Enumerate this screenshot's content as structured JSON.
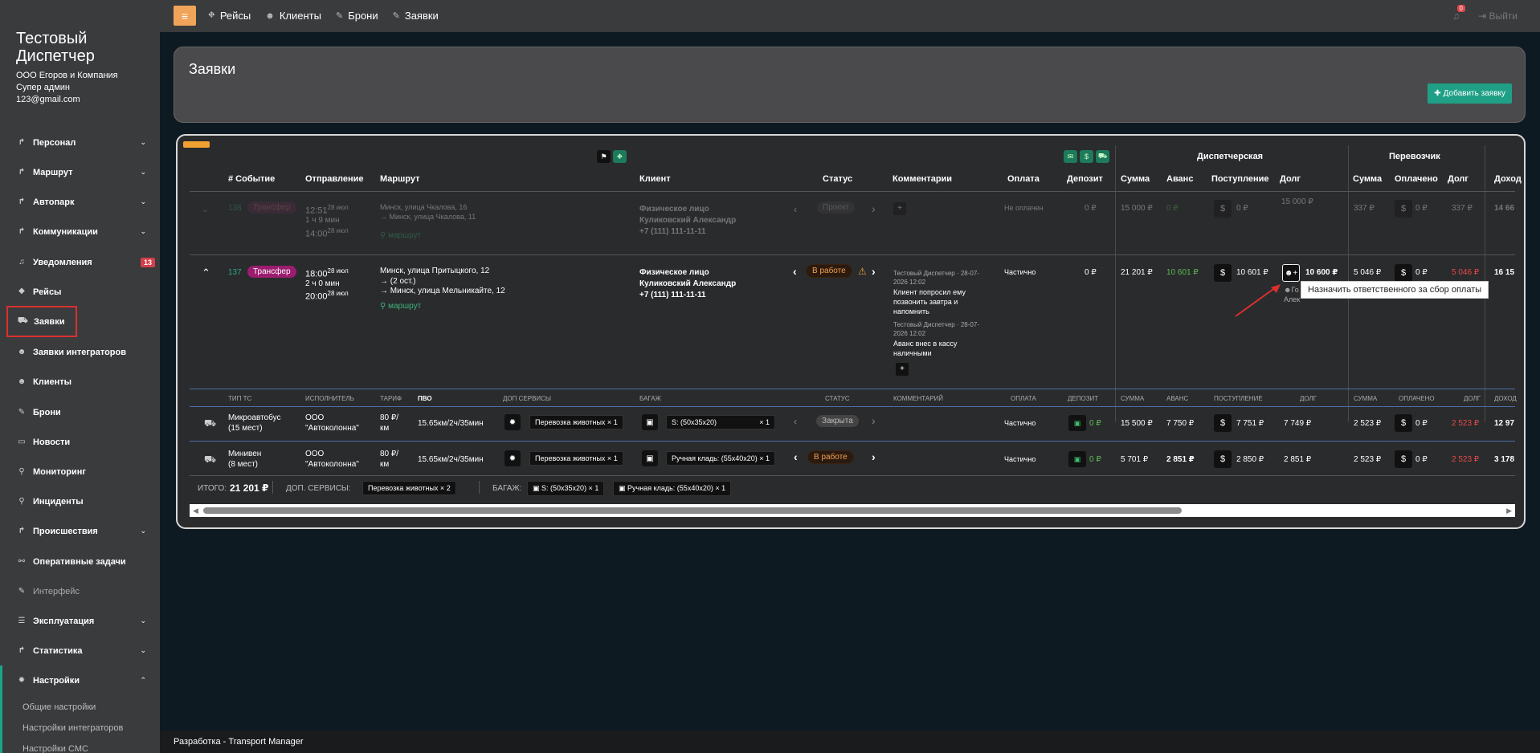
{
  "brand": {
    "title_line1": "Тестовый",
    "title_line2": "Диспетчер",
    "company": "ООО Егоров и Компания",
    "role": "Супер админ",
    "email": "123@gmail.com"
  },
  "sidebar": {
    "items": [
      {
        "label": "Персонал",
        "icon": "route-icon"
      },
      {
        "label": "Маршрут",
        "icon": "route-icon"
      },
      {
        "label": "Автопарк",
        "icon": "route-icon"
      },
      {
        "label": "Коммуникации",
        "icon": "route-icon"
      },
      {
        "label": "Уведомления",
        "icon": "bell-icon",
        "badge": "13"
      },
      {
        "label": "Рейсы",
        "icon": "road-icon"
      },
      {
        "label": "Заявки",
        "icon": "car-icon"
      },
      {
        "label": "Заявки интеграторов",
        "icon": "users-icon"
      },
      {
        "label": "Клиенты",
        "icon": "users-icon"
      },
      {
        "label": "Брони",
        "icon": "edit-icon"
      },
      {
        "label": "Новости",
        "icon": "chat-icon"
      },
      {
        "label": "Мониторинг",
        "icon": "pin-icon"
      },
      {
        "label": "Инциденты",
        "icon": "pin-icon"
      },
      {
        "label": "Происшествия",
        "icon": "route-icon"
      },
      {
        "label": "Оперативные задачи",
        "icon": "link-icon"
      },
      {
        "label": "Интерфейс",
        "icon": "edit-icon"
      },
      {
        "label": "Эксплуатация",
        "icon": "list-icon"
      },
      {
        "label": "Статистика",
        "icon": "route-icon"
      },
      {
        "label": "Настройки",
        "icon": "gear-icon"
      }
    ],
    "sub_items": [
      "Общие настройки",
      "Настройки интеграторов",
      "Настройки СМС"
    ]
  },
  "topbar": {
    "nav": [
      "Рейсы",
      "Клиенты",
      "Брони",
      "Заявки"
    ],
    "notif_count": "0",
    "logout": "Выйти"
  },
  "header": {
    "title": "Заявки",
    "add_button": "Добавить заявку"
  },
  "groups": {
    "dispatcher": "Диспетчерская",
    "carrier": "Перевозчик"
  },
  "columns": [
    "# Событие",
    "Отправление",
    "Маршрут",
    "Клиент",
    "Статус",
    "Комментарии",
    "Оплата",
    "Депозит",
    "Сумма",
    "Аванс",
    "Поступление",
    "Долг",
    "Сумма",
    "Оплачено",
    "Долг",
    "Доход"
  ],
  "rows": [
    {
      "id": "138",
      "type": "Трансфер",
      "time": "12:51",
      "date": "28 июл",
      "duration": "1 ч 9 мин",
      "arrive": "14:00",
      "arrive_date": "28 июл",
      "from": "Минск, улица Чкалова, 16",
      "to": "→ Минск, улица Чкалова, 11",
      "route_link": "маршрут",
      "client_type": "Физическое лицо",
      "client_name": "Куликовский Александр",
      "client_phone": "+7 (111) 111-11-11",
      "status": "Проект",
      "payment": "Не оплачен",
      "deposit": "0 ₽",
      "sum": "15 000 ₽",
      "advance": "0 ₽",
      "income": "0 ₽",
      "debt": "15 000 ₽",
      "c_sum": "337 ₽",
      "c_paid": "0 ₽",
      "c_debt": "337 ₽",
      "revenue": "14 66"
    },
    {
      "id": "137",
      "type": "Трансфер",
      "time": "18:00",
      "date": "28 июл",
      "duration": "2 ч 0 мин",
      "arrive": "20:00",
      "arrive_date": "28 июл",
      "from": "Минск, улица Притыцкого, 12",
      "stops": "→ (2 ост.)",
      "to": "→ Минск, улица Мельникайте, 12",
      "route_link": "маршрут",
      "client_type": "Физическое лицо",
      "client_name": "Куликовский Александр",
      "client_phone": "+7 (111) 111-11-11",
      "status": "В работе",
      "comments": [
        {
          "meta": "Тестовый Диспетчер · 28-07-2026 12:02",
          "text_lines": [
            "Клиент попросил ему",
            "позвонить завтра и",
            "напомнить"
          ]
        },
        {
          "meta": "Тестовый Диспетчер · 28-07-2026 12:02",
          "text_lines": [
            "Аванс внес в кассу",
            "наличными"
          ]
        }
      ],
      "payment": "Частично",
      "deposit": "0 ₽",
      "sum": "21 201 ₽",
      "advance": "10 601 ₽",
      "income": "10 601 ₽",
      "debt": "10 600 ₽",
      "debt_sub": "Го",
      "debt_sub2": "Алек",
      "c_sum": "5 046 ₽",
      "c_paid": "0 ₽",
      "c_debt": "5 046 ₽",
      "revenue": "16 15"
    }
  ],
  "tooltip": "Назначить ответственного за сбор оплаты",
  "sub_columns": [
    "Тип ТС",
    "Исполнитель",
    "Тариф",
    "ПВО",
    "Доп сервисы",
    "Багаж",
    "Статус",
    "Комментарий",
    "Оплата",
    "Депозит",
    "Сумма",
    "Аванс",
    "Поступление",
    "Долг",
    "Сумма",
    "Оплачено",
    "Долг",
    "Доход"
  ],
  "sub_rows": [
    {
      "vehicle": "Микроавтобус",
      "seats": "(15 мест)",
      "executor1": "ООО",
      "executor2": "\"Автоколонна\"",
      "tariff1": "80 ₽/",
      "tariff2": "км",
      "pvo": "15.65км/2ч/35мин",
      "service": "Перевозка животных × 1",
      "baggage": "S: (50x35x20)",
      "baggage_qty": "× 1",
      "status": "Закрыта",
      "payment": "Частично",
      "deposit": "0 ₽",
      "sum": "15 500 ₽",
      "advance": "7 750 ₽",
      "income": "7 751 ₽",
      "debt": "7 749 ₽",
      "c_sum": "2 523 ₽",
      "c_paid": "0 ₽",
      "c_debt": "2 523 ₽",
      "revenue": "12 97"
    },
    {
      "vehicle": "Минивен",
      "seats": "(8 мест)",
      "executor1": "ООО",
      "executor2": "\"Автоколонна\"",
      "tariff1": "80 ₽/",
      "tariff2": "км",
      "pvo": "15.65км/2ч/35мин",
      "service": "Перевозка животных × 1",
      "baggage": "Ручная кладь: (55x40x20) × 1",
      "status": "В работе",
      "payment": "Частично",
      "deposit": "0 ₽",
      "sum": "5 701 ₽",
      "advance": "2 851 ₽",
      "income": "2 850 ₽",
      "debt": "2 851 ₽",
      "c_sum": "2 523 ₽",
      "c_paid": "0 ₽",
      "c_debt": "2 523 ₽",
      "revenue": "3 178"
    }
  ],
  "totals": {
    "label": "ИТОГО:",
    "value": "21 201 ₽",
    "services_label": "ДОП. СЕРВИСЫ:",
    "services_chip": "Перевозка животных × 2",
    "baggage_label": "БАГАЖ:",
    "baggage_chip1": "S: (50x35x20) × 1",
    "baggage_chip2": "Ручная кладь: (55x40x20) × 1"
  },
  "footer": "Разработка - Transport Manager",
  "colors": {
    "accent": "#1fa086",
    "menu": "#f0a45a",
    "transfer": "#9c1d6f",
    "danger": "#e84848"
  }
}
